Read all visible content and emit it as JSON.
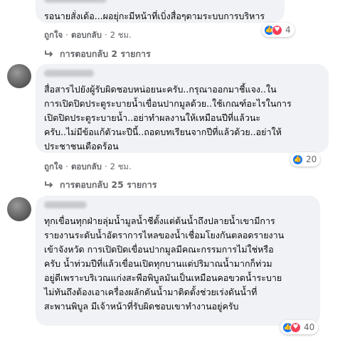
{
  "comments": [
    {
      "text": "รอนายสั่งเด้อ...ผอยุ่กะมีหน้าที่เบิ่งสื่อๆตามระบบการบริหาร",
      "reaction_count": "4",
      "like_label": "ถูกใจ",
      "reply_label": "ตอบกลับ",
      "time": "2 ชม.",
      "replies_label": "การตอบกลับ 2 รายการ"
    },
    {
      "text": "สื่อสารไปยังผู้รับผิดชอบหน่อยนะครับ..กรุณาออกมาชี้แจง..ใน\nการเปิดปิดประตูระบายน้ำเขื่อนปากมูลด้วย..ใช้เกณฑ์อะไรในการ\nเปิดปิดประตูระบายน้ำ..อย่าทำผลงานให้เหมือนปีที่แล้วนะ\nครับ..ไม่มีข้อแก้ตัวนะปีนี้..ถอดบทเรียนจากปีที่แล้วด้วย..อย่าให้\nประชาชนเดือดร้อน",
      "reaction_count": "20",
      "like_label": "ถูกใจ",
      "reply_label": "ตอบกลับ",
      "time": "2 ชม.",
      "replies_label": "การตอบกลับ 25 รายการ"
    },
    {
      "text": "ทุกเขื่อนทุกฝ่ายลุ่มน้ำมูลน้ำชีตั้งแต่ต้นน้ำถึงปลายน้ำเขามีการ\nรายงานระดับน้ำอัตราการไหลของน้ำเชื่อมโยงกันตลอดรายงาน\nเข้าจังหวัด การเปิดปิดเขื่อนปากมูลมีคณะกรรมการไม่ใช่หรือ\nครับ น้ำท่วมปีที่แล้วเขื่อนเปิดทุกบานแต่ปริมาณน้ำมากก็ท่วม\nอยู่ดีเพราะบริเวณแก่งสะพือพิบูลมันเป็นเหมือนคอขวดน้ำระบาย\nไม่ทันถึงต้องเอาเครื่องผลักดันน้ำมาติดตั้งช่วยเร่งดันน้ำที่\nสะพานพิบูล มีเจ้าหน้าที่รับผิดชอบเขาทำงานอยู่ครับ",
      "reaction_count": "40"
    }
  ]
}
